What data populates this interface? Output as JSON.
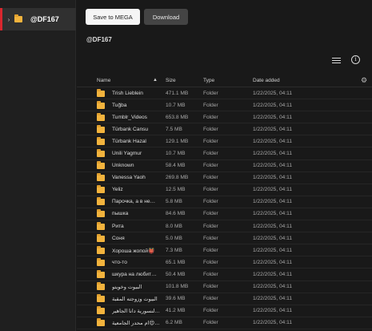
{
  "sidebar": {
    "items": [
      {
        "label": "@DF167",
        "icon": "folder-icon",
        "expand_icon": "chevron-right-icon"
      }
    ]
  },
  "toolbar": {
    "save_label": "Save to MEGA",
    "download_label": "Download"
  },
  "breadcrumb": {
    "current": "@DF167"
  },
  "view_icons": {
    "list": "list-view-icon",
    "info": "info-icon",
    "info_glyph": "i"
  },
  "table": {
    "columns": {
      "name": "Name",
      "size": "Size",
      "type": "Type",
      "date": "Date added",
      "sort": "▲"
    },
    "settings_glyph": "⚙",
    "rows": [
      {
        "name": "Trish Lieblein",
        "size": "471.1 MB",
        "type": "Folder",
        "date": "1/22/2025, 04:11"
      },
      {
        "name": "Tuğba",
        "size": "10.7 MB",
        "type": "Folder",
        "date": "1/22/2025, 04:11"
      },
      {
        "name": "Tumblr_Videos",
        "size": "653.8 MB",
        "type": "Folder",
        "date": "1/22/2025, 04:11"
      },
      {
        "name": "Türbank Cansu",
        "size": "7.5 MB",
        "type": "Folder",
        "date": "1/22/2025, 04:11"
      },
      {
        "name": "Türbank Hazal",
        "size": "129.1 MB",
        "type": "Folder",
        "date": "1/22/2025, 04:11"
      },
      {
        "name": "Unili Yagmur",
        "size": "10.7 MB",
        "type": "Folder",
        "date": "1/22/2025, 04:11"
      },
      {
        "name": "Unknown",
        "size": "58.4 MB",
        "type": "Folder",
        "date": "1/22/2025, 04:11"
      },
      {
        "name": "Vanessa Yaoh",
        "size": "269.8 MB",
        "type": "Folder",
        "date": "1/22/2025, 04:11"
      },
      {
        "name": "Yeliz",
        "size": "12.5 MB",
        "type": "Folder",
        "date": "1/22/2025, 04:11"
      },
      {
        "name": "Парочка, а в не…",
        "size": "5.8 MB",
        "type": "Folder",
        "date": "1/22/2025, 04:11"
      },
      {
        "name": "пышка",
        "size": "84.6 MB",
        "type": "Folder",
        "date": "1/22/2025, 04:11"
      },
      {
        "name": "Рита",
        "size": "8.0 MB",
        "type": "Folder",
        "date": "1/22/2025, 04:11"
      },
      {
        "name": "Соня",
        "size": "5.0 MB",
        "type": "Folder",
        "date": "1/22/2025, 04:11"
      },
      {
        "name": "Хороша жопой👹",
        "size": "7.3 MB",
        "type": "Folder",
        "date": "1/22/2025, 04:11"
      },
      {
        "name": "что-то",
        "size": "65.1 MB",
        "type": "Folder",
        "date": "1/22/2025, 04:11"
      },
      {
        "name": "шкура на любит…",
        "size": "50.4 MB",
        "type": "Folder",
        "date": "1/22/2025, 04:11"
      },
      {
        "name": "البيوت وخويتو",
        "size": "101.8 MB",
        "type": "Folder",
        "date": "1/22/2025, 04:11"
      },
      {
        "name": "البيوت وزوجته المقبة",
        "size": "39.6 MB",
        "type": "Folder",
        "date": "1/22/2025, 04:11"
      },
      {
        "name": "بنقلة النسورية دانا الجاهير",
        "size": "41.2 MB",
        "type": "Folder",
        "date": "1/22/2025, 04:11"
      },
      {
        "name": "ام محدر الجامعية😍😍",
        "size": "6.2 MB",
        "type": "Folder",
        "date": "1/22/2025, 04:11"
      }
    ]
  },
  "colors": {
    "accent": "#d9272e",
    "folder": "#f2b33d",
    "background": "#191919",
    "sidebar": "#1f1f1f"
  }
}
